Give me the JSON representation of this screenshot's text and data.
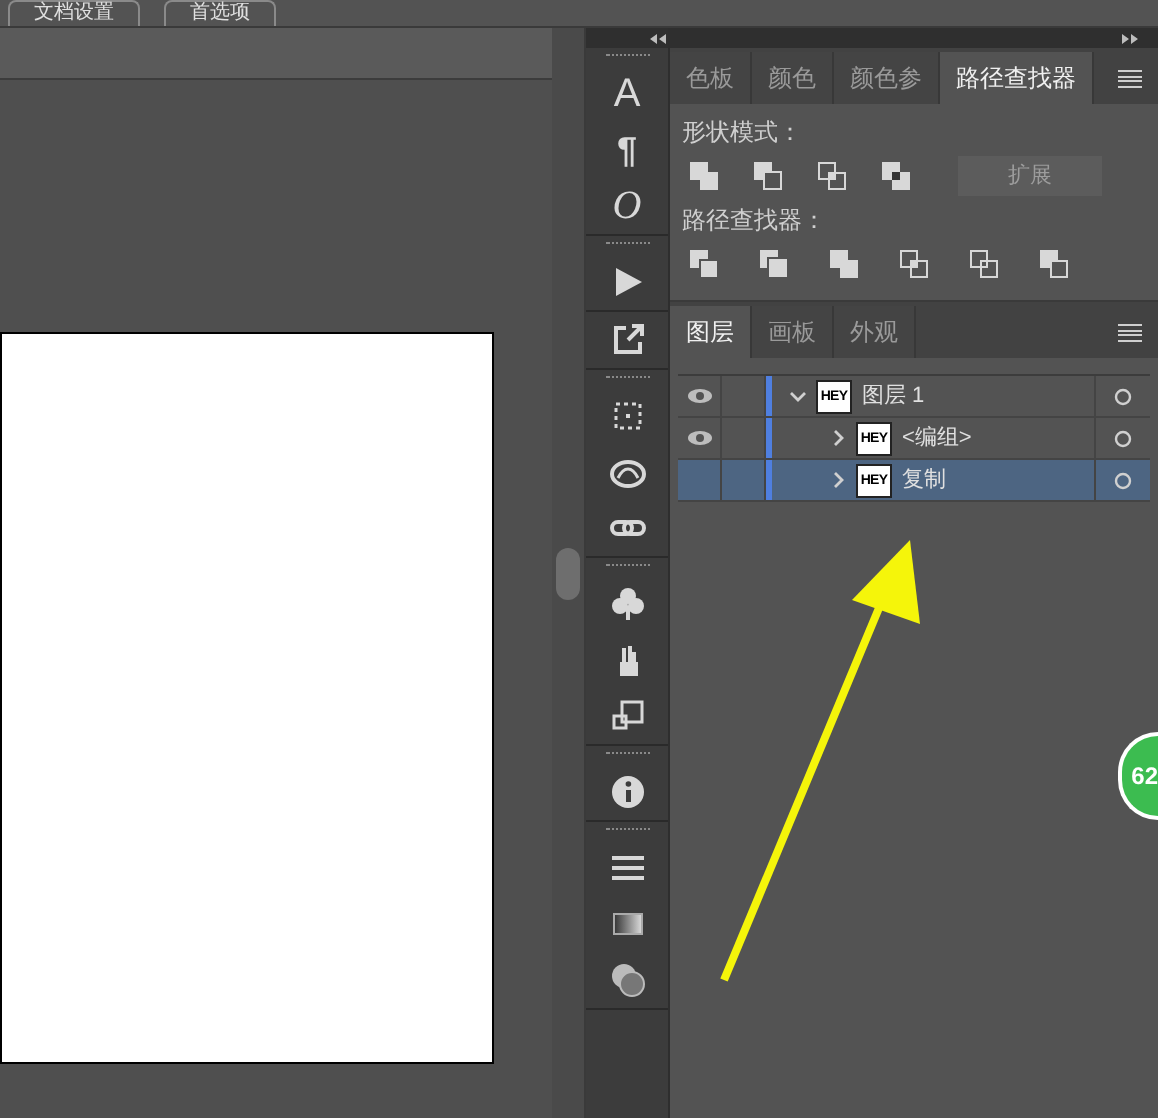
{
  "top_bar": {
    "buttons": [
      "文档设置",
      "首选项"
    ]
  },
  "toolbar_glyphs": [
    "A",
    "¶",
    "O"
  ],
  "panel_tabs": [
    {
      "label": "色板",
      "selected": false
    },
    {
      "label": "颜色",
      "selected": false
    },
    {
      "label": "颜色参",
      "selected": false
    },
    {
      "label": "路径查找器",
      "selected": true
    }
  ],
  "pathfinder": {
    "shape_modes_label": "形状模式：",
    "expand_button": {
      "label": "扩展",
      "disabled": true
    },
    "pathfinders_label": "路径查找器："
  },
  "layers_tabs": [
    {
      "label": "图层",
      "selected": true
    },
    {
      "label": "画板",
      "selected": false
    },
    {
      "label": "外观",
      "selected": false
    }
  ],
  "layers": [
    {
      "name": "图层 1",
      "thumb": "HEY",
      "visible": true,
      "expanded": true,
      "selected": false,
      "children": [
        {
          "name": "<编组>",
          "thumb": "HEY",
          "visible": true,
          "expanded": false,
          "selected": false
        },
        {
          "name": "复制",
          "thumb": "HEY",
          "visible": false,
          "expanded": false,
          "selected": true
        }
      ]
    }
  ],
  "badge": "62"
}
